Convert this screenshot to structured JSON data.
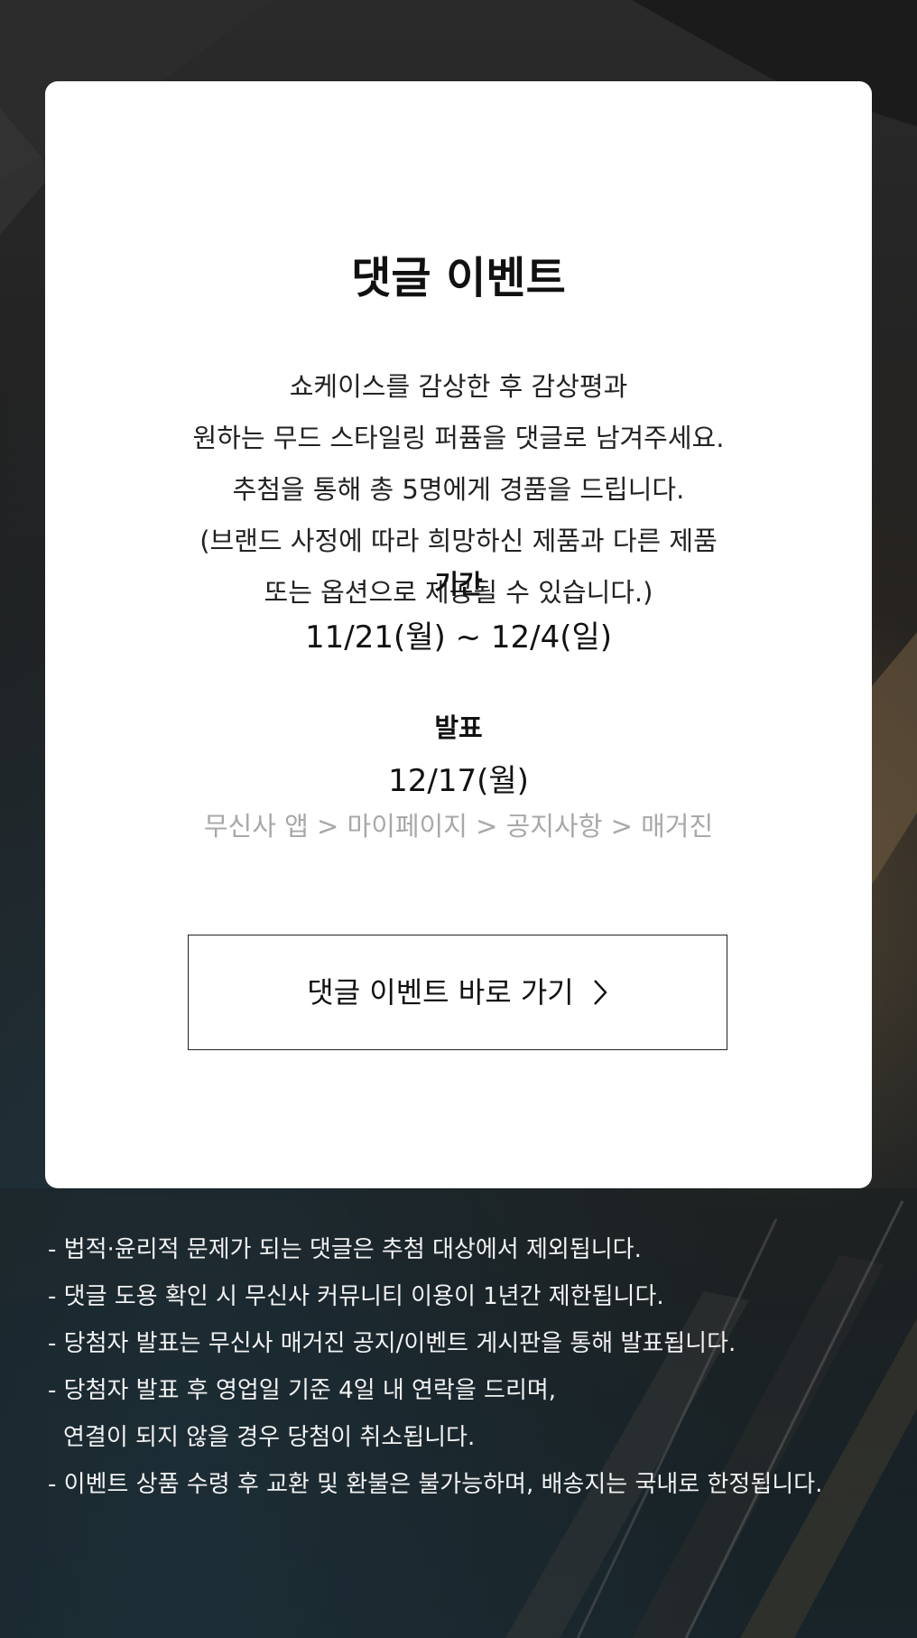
{
  "event": {
    "title": "댓글 이벤트",
    "description_lines": [
      "쇼케이스를 감상한 후 감상평과",
      "원하는 무드 스타일링 퍼퓸을 댓글로 남겨주세요.",
      "추첨을 통해 총 5명에게 경품을 드립니다.",
      "(브랜드 사정에 따라 희망하신 제품과 다른 제품",
      "또는 옵션으로 제공될 수 있습니다.)"
    ],
    "period_label": "기간",
    "period_value": "11/21(월) ~ 12/4(일)",
    "announce_label": "발표",
    "announce_value": "12/17(월)",
    "announce_path": "무신사 앱 > 마이페이지 > 공지사항 > 매거진",
    "button_label": "댓글 이벤트 바로 가기"
  },
  "notes": [
    "- 법적·윤리적 문제가 되는 댓글은 추첨 대상에서 제외됩니다.",
    "- 댓글 도용 확인 시 무신사 커뮤니티 이용이 1년간 제한됩니다.",
    "- 당첨자 발표는 무신사 매거진 공지/이벤트 게시판을 통해 발표됩니다.",
    "- 당첨자 발표 후 영업일 기준 4일 내 연락을 드리며,",
    "연결이 되지 않을 경우 당첨이 취소됩니다.",
    "- 이벤트 상품 수령 후 교환 및 환불은 불가능하며, 배송지는 국내로 한정됩니다."
  ],
  "icons": {
    "button_arrow": "chevron-right-icon"
  },
  "colors": {
    "card_background": "#ffffff",
    "path_text": "#a8a8a8",
    "notes_text": "#f2f2f2"
  }
}
